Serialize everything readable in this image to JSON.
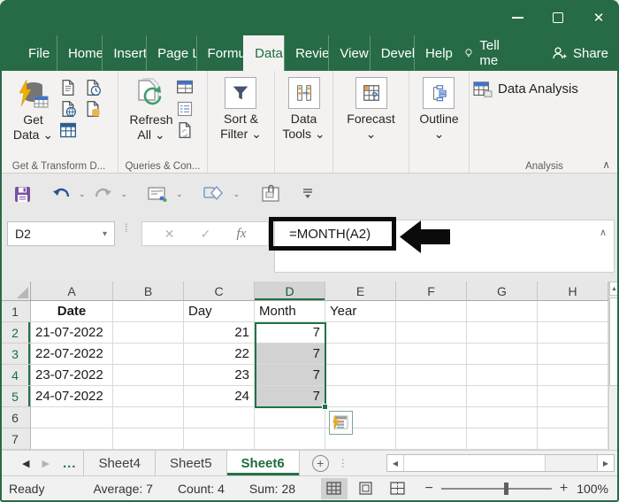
{
  "titlebar": {
    "close": "✕"
  },
  "tabs": {
    "items": [
      "File",
      "Home",
      "Insert",
      "Page L",
      "Formu",
      "Data",
      "Revie",
      "View",
      "Devel",
      "Help"
    ],
    "active": "Data",
    "tell_me": "Tell me",
    "share": "Share"
  },
  "ribbon": {
    "get_data_l1": "Get",
    "get_data_l2": "Data ⌄",
    "refresh_l1": "Refresh",
    "refresh_l2": "All ⌄",
    "sort_l1": "Sort &",
    "sort_l2": "Filter ⌄",
    "tools_l1": "Data",
    "tools_l2": "Tools ⌄",
    "forecast_l1": "Forecast",
    "forecast_l2": "⌄",
    "outline_l1": "Outline",
    "outline_l2": "⌄",
    "data_analysis": "Data Analysis",
    "labels": {
      "g1": "Get & Transform D...",
      "g2": "Queries & Con...",
      "g7": "Analysis"
    },
    "collapse": "∧"
  },
  "qat": {
    "caret": "⌄"
  },
  "formula_bar": {
    "name_box": "D2",
    "name_caret": "▾",
    "dots": "⁞",
    "cancel": "✕",
    "enter": "✓",
    "fx": "fx",
    "formula": "=MONTH(A2)",
    "collapse": "∧"
  },
  "grid": {
    "columns": [
      "A",
      "B",
      "C",
      "D",
      "E",
      "F",
      "G",
      "H"
    ],
    "selected_column": "D",
    "selected_range": "D2:D5",
    "row_numbers": [
      "1",
      "2",
      "3",
      "4",
      "5",
      "6",
      "7"
    ],
    "rows": [
      [
        "Date",
        "",
        "Day",
        "Month",
        "Year",
        "",
        "",
        ""
      ],
      [
        "21-07-2022",
        "",
        "21",
        "7",
        "",
        "",
        "",
        ""
      ],
      [
        "22-07-2022",
        "",
        "22",
        "7",
        "",
        "",
        "",
        ""
      ],
      [
        "23-07-2022",
        "",
        "23",
        "7",
        "",
        "",
        "",
        ""
      ],
      [
        "24-07-2022",
        "",
        "24",
        "7",
        "",
        "",
        "",
        ""
      ],
      [
        "",
        "",
        "",
        "",
        "",
        "",
        "",
        ""
      ],
      [
        "",
        "",
        "",
        "",
        "",
        "",
        "",
        ""
      ]
    ]
  },
  "scrollbars": {
    "up": "▲",
    "left": "◀",
    "right": "▶"
  },
  "sheet_bar": {
    "prev": "◀",
    "next": "▶",
    "more": "...",
    "sheets": [
      "Sheet4",
      "Sheet5"
    ],
    "active": "Sheet6",
    "add": "+"
  },
  "status_bar": {
    "mode": "Ready",
    "average": "Average: 7",
    "count": "Count: 4",
    "sum": "Sum: 28",
    "minus": "−",
    "plus": "+",
    "zoom": "100%"
  },
  "colors": {
    "accent_green": "#217346",
    "titlebar_green": "#266b45",
    "selection_fill": "#d2d2d2",
    "ribbon_bg": "#f3f2f1"
  }
}
